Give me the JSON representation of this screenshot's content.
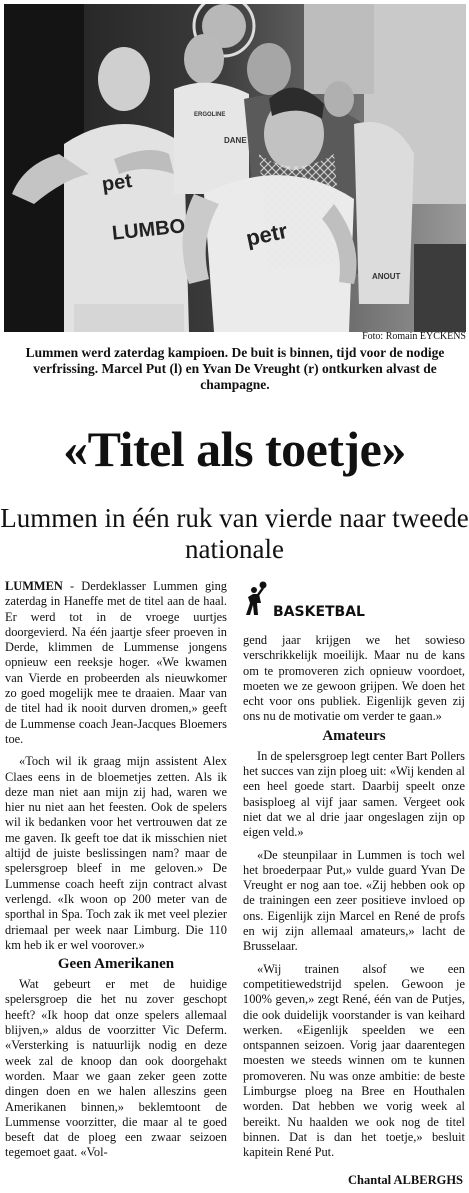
{
  "photo": {
    "credit": "Foto: Romain EYCKENS",
    "jersey_texts": [
      "pet",
      "LUMBO",
      "petr",
      "ERGOLINE",
      "DANE",
      "ANOUT"
    ]
  },
  "caption": "Lummen werd zaterdag kampioen. De buit is binnen, tijd voor de nodige verfrissing. Marcel Put (l) en Yvan De Vreught (r) ontkurken alvast de champagne.",
  "headline": "«Titel als toetje»",
  "subheadline": "Lummen in één ruk van vierde naar tweede nationale",
  "rubric": {
    "label": "BASKETBAL",
    "icon": "basketball-player-icon"
  },
  "article": {
    "dateline": "LUMMEN",
    "left_column": {
      "p1": " - Derdeklasser Lummen ging zaterdag in Haneffe met de titel aan de haal. Er werd tot in de vroege uurtjes doorgevierd. Na één jaartje sfeer proeven in Derde, klimmen de Lummense jongens opnieuw een reeksje hoger. «We kwamen van Vierde en probeerden als nieuwkomer zo goed mogelijk mee te draaien. Maar van de titel had ik nooit durven dromen,» geeft de Lummense coach Jean-Jacques Bloemers toe.",
      "p2": "«Toch wil ik graag mijn assistent Alex Claes eens in de bloemetjes zetten. Als ik deze man niet aan mijn zij had, waren we hier nu niet aan het feesten. Ook de spelers wil ik bedanken voor het vertrouwen dat ze me gaven. Ik geeft toe dat ik misschien niet altijd de juiste beslissingen nam? maar de spelersgroep bleef in me geloven.» De Lummense coach heeft zijn contract alvast verlengd. «Ik woon op 200 meter van de sporthal in Spa. Toch zak ik met veel plezier driemaal per week naar Limburg. Die 110 km heb ik er wel voorover.»",
      "subhead": "Geen Amerikanen",
      "p3": "Wat gebeurt er met de huidige spelersgroep die het nu zover geschopt heeft? «Ik hoop dat onze spelers allemaal blijven,» aldus de voorzitter Vic Deferm. «Versterking is natuurlijk nodig en deze week zal de knoop dan ook doorgehakt worden. Maar we gaan zeker geen zotte dingen doen en we halen alleszins geen Amerikanen binnen,» beklemtoont de Lummense voorzitter, die maar al te goed beseft dat de ploeg een zwaar seizoen tegemoet gaat. «Vol-"
    },
    "right_column": {
      "p1": "gend jaar krijgen we het sowieso verschrikkelijk moeilijk. Maar nu de kans om te promoveren zich opnieuw voordoet, moeten we ze gewoon grijpen. We doen het echt voor ons publiek. Eigenlijk geven zij ons nu de motivatie om verder te gaan.»",
      "subhead": "Amateurs",
      "p2": "In de spelersgroep legt center Bart Pollers het succes van zijn ploeg uit: «Wij kenden al een heel goede start. Daarbij speelt onze basisploeg al vijf jaar samen. Vergeet ook niet dat we al drie jaar ongeslagen zijn op eigen veld.»",
      "p3": "«De steunpilaar in Lummen is toch wel het broederpaar Put,» vulde guard Yvan De Vreught er nog aan toe. «Zij hebben ook op de trainingen een zeer positieve invloed op ons. Eigenlijk zijn Marcel en René de profs en wij zijn allemaal amateurs,» lacht de Brusselaar.",
      "p4": "«Wij trainen alsof we een competitiewedstrijd spelen. Gewoon je 100% geven,» zegt René, één van de Putjes, die ook duidelijk voorstander is van keihard werken. «Eigenlijk speelden we een ontspannen seizoen. Vorig jaar daarentegen moesten we steeds winnen om te kunnen promoveren. Nu was onze ambitie: de beste Limburgse ploeg na Bree en Houthalen worden. Dat hebben we vorig week al bereikt. Nu haalden we ook nog de titel binnen. Dat is dan het toetje,» besluit kapitein René Put."
    },
    "byline": "Chantal ALBERGHS"
  }
}
